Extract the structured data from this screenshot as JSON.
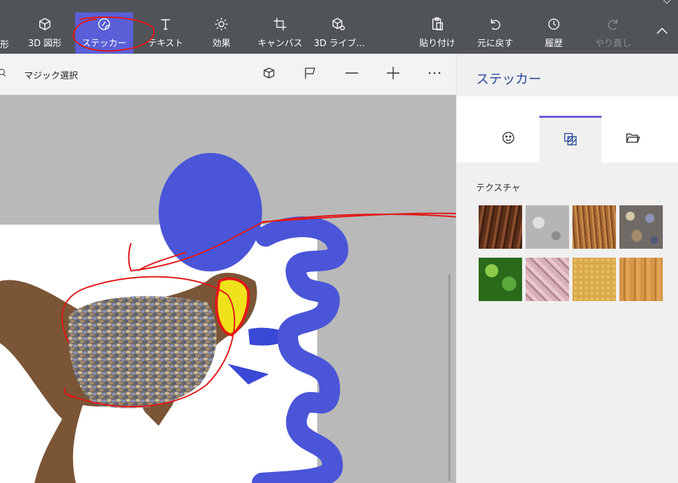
{
  "toolbar": {
    "partial_left_label": "形",
    "items": [
      {
        "id": "shapes3d",
        "label": "3D 図形",
        "icon": "cube-icon"
      },
      {
        "id": "stickers",
        "label": "ステッカー",
        "icon": "sticker-icon",
        "active": true
      },
      {
        "id": "text",
        "label": "テキスト",
        "icon": "text-icon"
      },
      {
        "id": "effects",
        "label": "効果",
        "icon": "sun-icon"
      },
      {
        "id": "canvas",
        "label": "キャンバス",
        "icon": "crop-icon"
      },
      {
        "id": "library3d",
        "label": "3D ライブ...",
        "icon": "library-icon"
      },
      {
        "id": "paste",
        "label": "貼り付け",
        "icon": "clipboard-icon"
      },
      {
        "id": "undo",
        "label": "元に戻す",
        "icon": "undo-icon"
      },
      {
        "id": "history",
        "label": "履歴",
        "icon": "history-icon"
      },
      {
        "id": "redo",
        "label": "やり直し",
        "icon": "redo-icon",
        "disabled": true
      }
    ],
    "collapse_icon": "chevron-up-icon"
  },
  "subbar": {
    "magic_select_label": "マジック選択"
  },
  "panel": {
    "title": "ステッカー",
    "tabs": [
      {
        "id": "stickers",
        "icon": "smiley-sticker-icon"
      },
      {
        "id": "textures",
        "icon": "texture-icon",
        "active": true
      },
      {
        "id": "custom",
        "icon": "folder-icon"
      }
    ],
    "section_label": "テクスチャ",
    "textures": [
      {
        "name": "bark",
        "color": "#6b3a22"
      },
      {
        "name": "granite",
        "color": "#b5b5b5"
      },
      {
        "name": "hair",
        "color": "#a0683a"
      },
      {
        "name": "pebbles",
        "color": "#7a6a58"
      },
      {
        "name": "leaves",
        "color": "#3f8a2a"
      },
      {
        "name": "marble",
        "color": "#c9a0a8"
      },
      {
        "name": "sand",
        "color": "#d8a84a"
      },
      {
        "name": "wood",
        "color": "#c98a3c"
      }
    ]
  },
  "colors": {
    "toolbar_bg": "#505459",
    "accent": "#5a5fd8",
    "blue_shape": "#4a55d8",
    "annotation_red": "#e01818"
  }
}
